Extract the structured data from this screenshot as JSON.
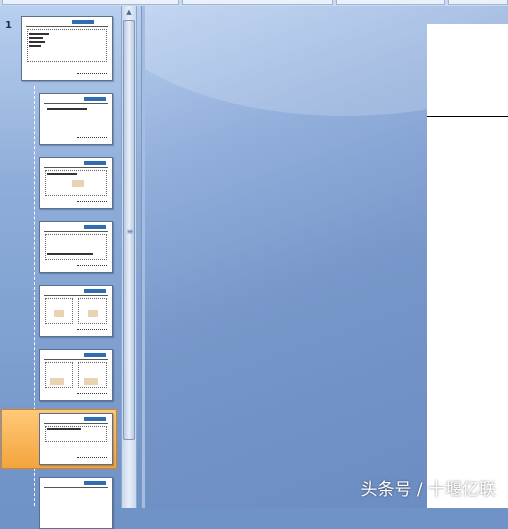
{
  "thumbnail_pane": {
    "first_slide_number": "1",
    "slide_count_visible": 8,
    "selected_slide_index": 7
  },
  "watermark": {
    "text": "头条号 / 十堰亿联"
  },
  "colors": {
    "selection": "#f4a43c",
    "workspace": "#6f93c6"
  },
  "icons": {
    "scroll_up": "triangle-up",
    "scroll_grip": "grip-lines"
  }
}
